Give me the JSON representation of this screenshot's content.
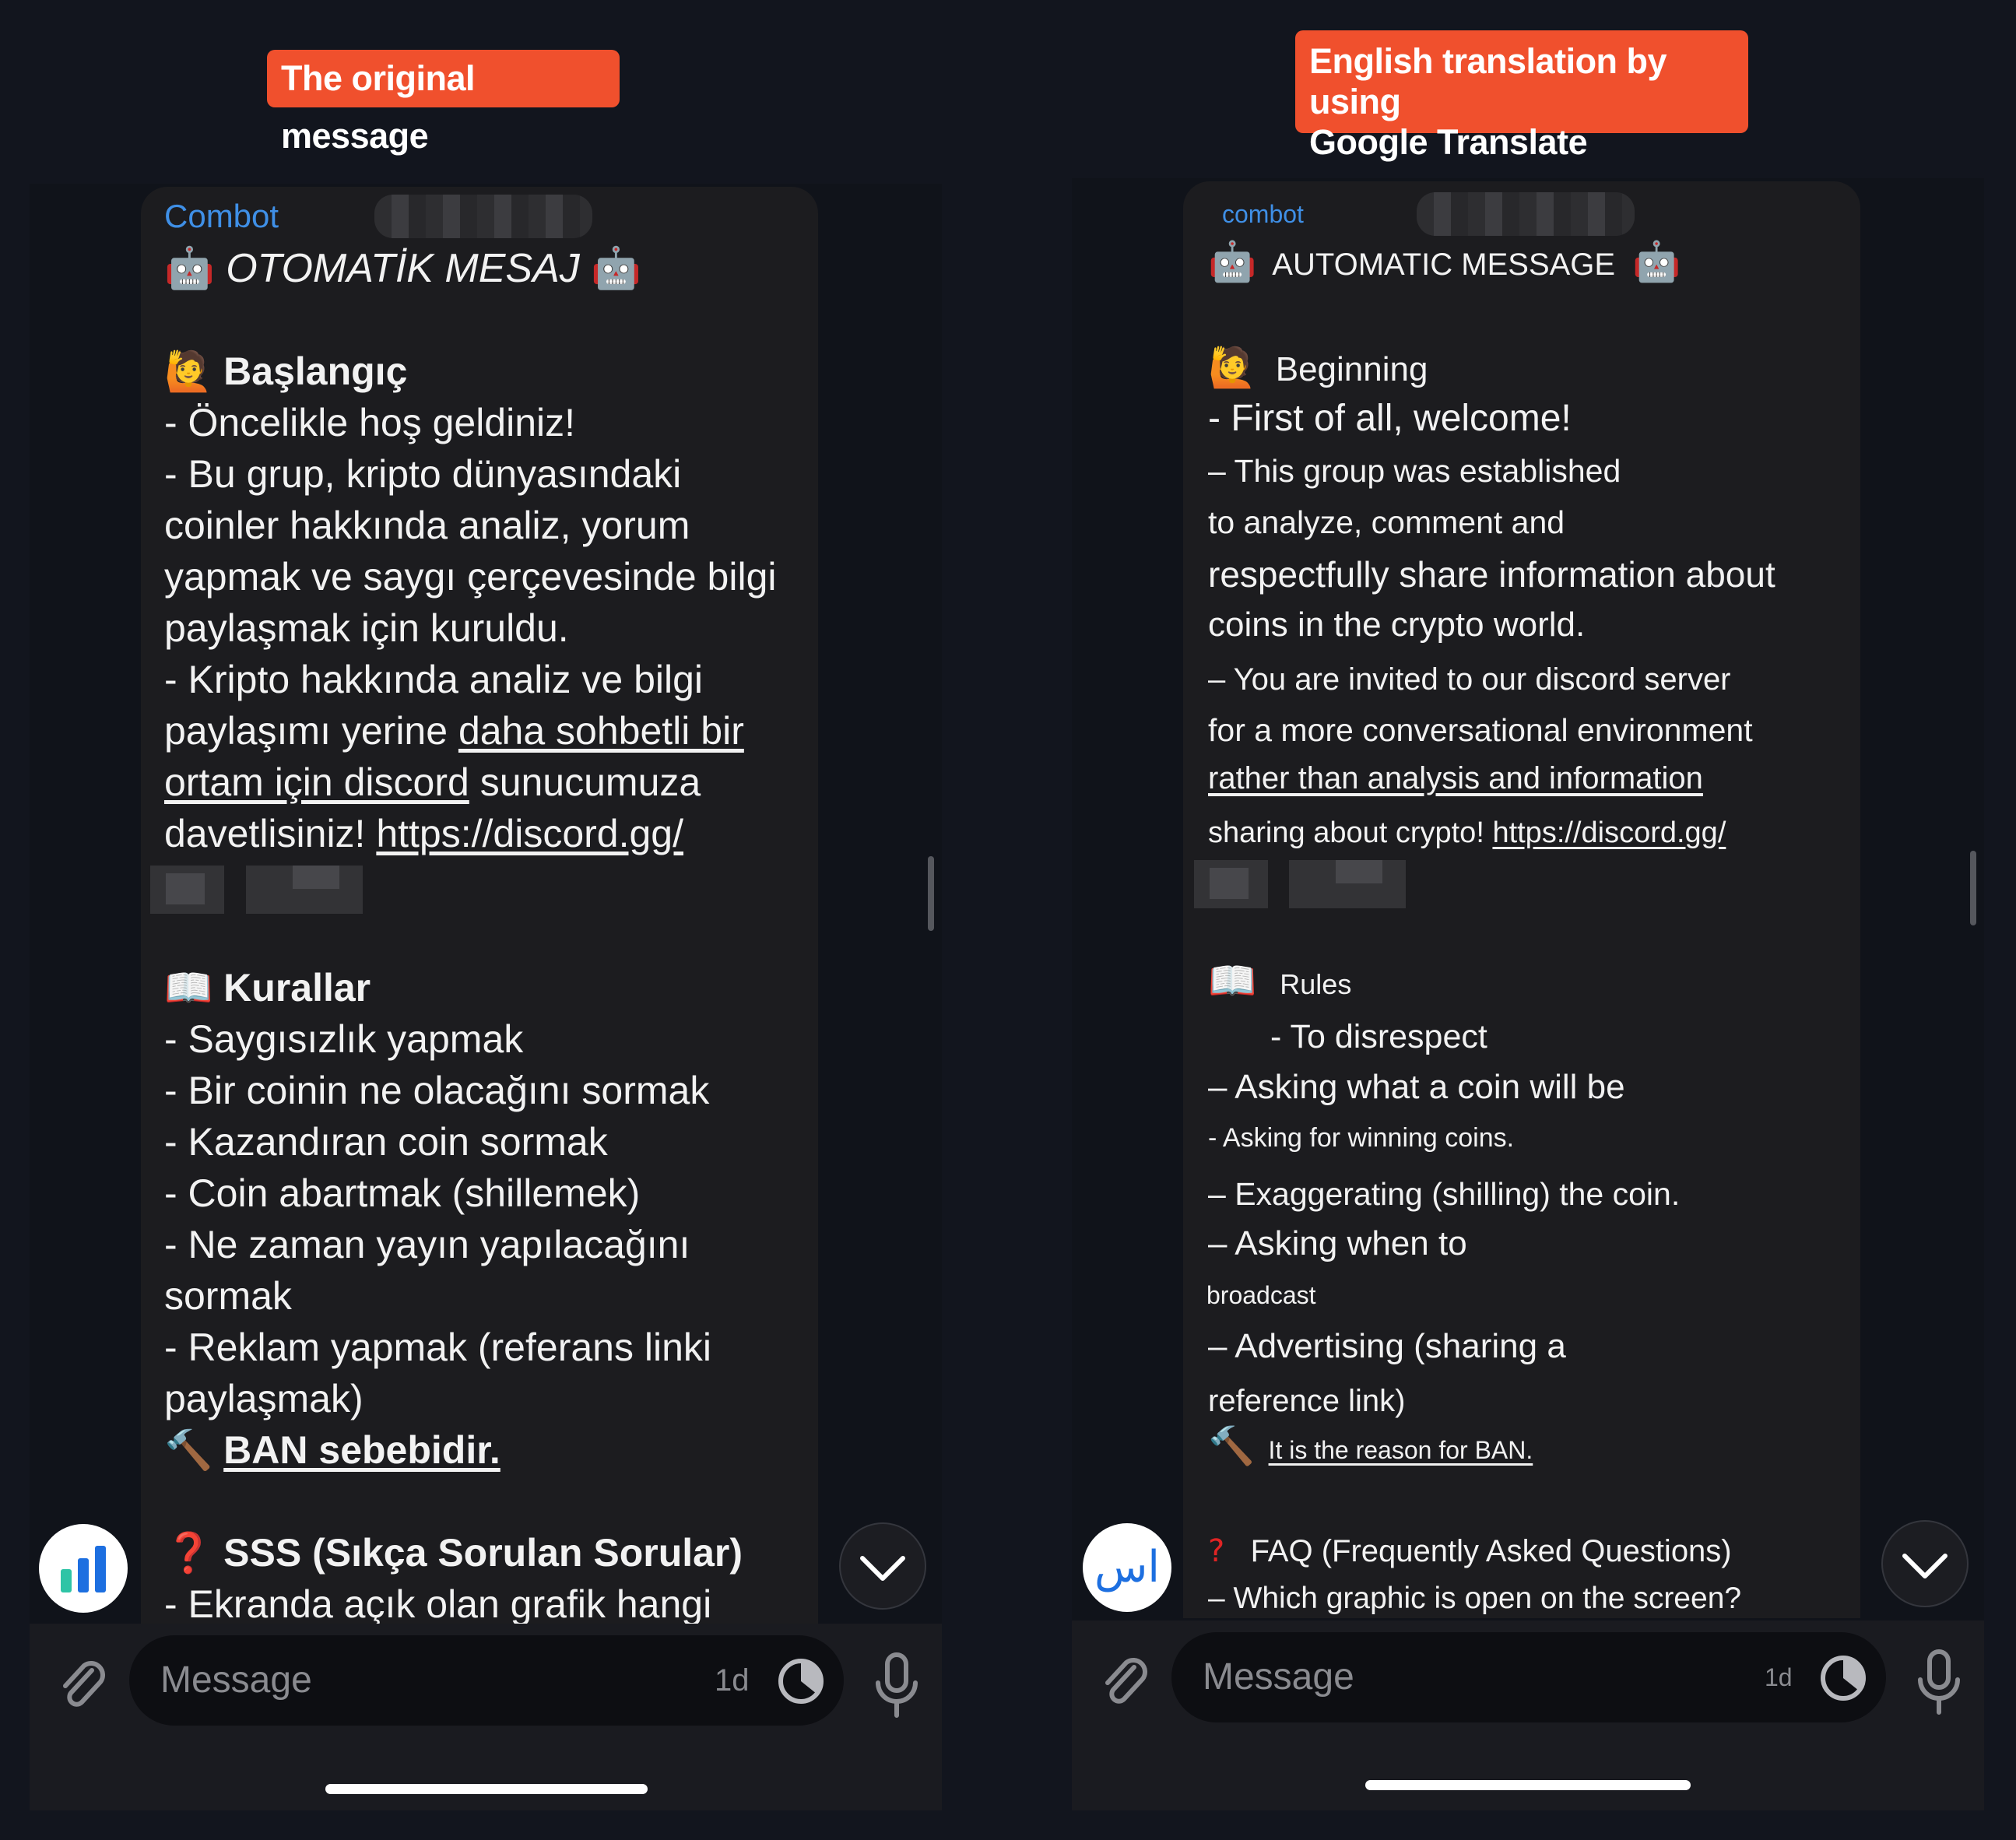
{
  "labels": {
    "left": "The original message",
    "right_line1": "English translation by using",
    "right_line2": "Google Translate"
  },
  "left": {
    "sender": "Combot",
    "title": "OTOMATİK MESAJ",
    "start_heading": "Başlangıç",
    "start_lines": [
      "- Öncelikle hoş geldiniz!",
      "- Bu grup, kripto dünyasındaki",
      "coinler hakkında analiz, yorum",
      "yapmak ve saygı çerçevesinde bilgi",
      "paylaşmak için kuruldu.",
      "- Kripto hakkında analiz ve bilgi"
    ],
    "invite_prefix": "paylaşımı yerine ",
    "invite_ul1": "daha sohbetli bir ",
    "invite_ul2": "ortam için discord",
    "invite_mid": " sunucumuza",
    "invite_last": "davetlisiniz! ",
    "invite_link": "https://discord.gg/",
    "rules_heading": "Kurallar",
    "rules_lines": [
      "- Saygısızlık yapmak",
      "- Bir coinin ne olacağını sormak",
      "- Kazandıran coin sormak",
      "- Coin abartmak (shillemek)",
      "- Ne zaman yayın yapılacağını",
      "sormak",
      "- Reklam yapmak (referans linki",
      "paylaşmak)"
    ],
    "ban_text": "BAN sebebidir.",
    "faq_heading": "SSS (Sıkça Sorulan Sorular)",
    "faq_line": "- Ekranda açık olan grafik hangi",
    "input_placeholder": "Message",
    "timer_label": "1d"
  },
  "right": {
    "sender": "combot",
    "title": "AUTOMATIC MESSAGE",
    "start_heading": "Beginning",
    "welcome": "- First of all, welcome!",
    "start_lines": [
      "– This group was established",
      "to analyze, comment and",
      "respectfully share information about",
      "coins in the crypto world.",
      "– You are invited to our discord server",
      "for a more conversational environment",
      "rather than analysis and information"
    ],
    "sharing_prefix": "sharing about crypto! ",
    "sharing_link": "https://discord.gg/",
    "rules_heading": "Rules",
    "rules_lines": [
      "- To disrespect",
      "– Asking what a coin will be",
      "- Asking for winning coins.",
      "– Exaggerating (shilling) the coin.",
      "– Asking when to",
      "broadcast",
      "– Advertising (sharing a",
      "reference link)"
    ],
    "ban_text": "It is the reason for BAN.",
    "faq_heading": "FAQ (Frequently Asked Questions)",
    "faq_line": "– Which graphic is open on the screen?",
    "avatar_text": "اس",
    "input_placeholder": "Message",
    "timer_label": "1d"
  },
  "colors": {
    "label_bg": "#f0502d",
    "sender": "#3f8fe6",
    "bubble_bg": "#1c1c1f",
    "chart_icon": "#1d6fe0"
  },
  "icons": [
    "robot-icon",
    "person-raising-hand-icon",
    "book-icon",
    "hammer-icon",
    "question-mark-icon",
    "bar-chart-icon",
    "chevron-down-icon",
    "paperclip-icon",
    "timer-icon",
    "microphone-icon"
  ]
}
